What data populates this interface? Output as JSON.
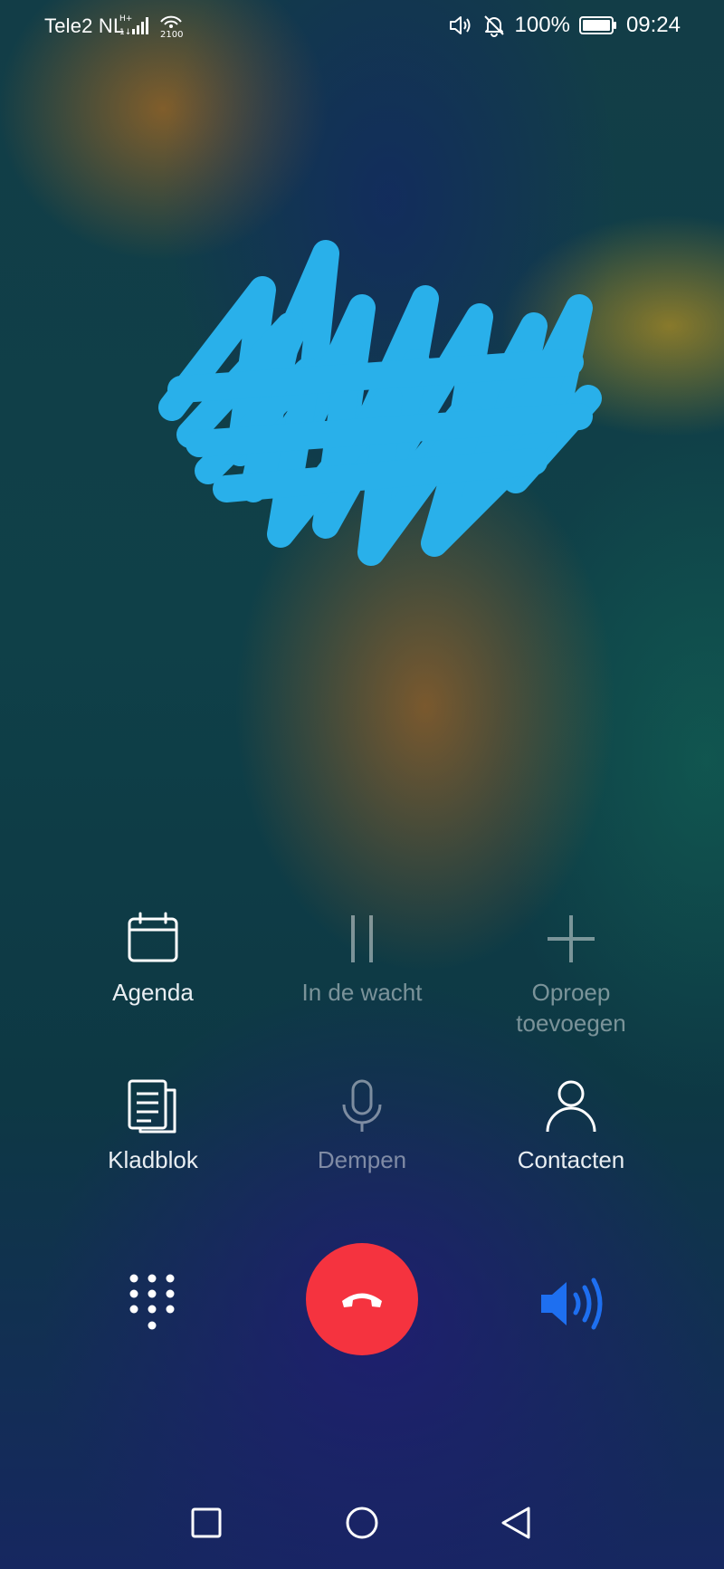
{
  "status_bar": {
    "carrier": "Tele2 NL",
    "network_badge": "2100",
    "battery_percent": "100%",
    "time": "09:24",
    "icons": [
      "signal-icon",
      "wifi-icon",
      "volume-icon",
      "bell-off-icon",
      "battery-icon"
    ]
  },
  "call": {
    "contact_name_redacted": true
  },
  "controls": {
    "agenda": {
      "label": "Agenda",
      "icon": "calendar-icon",
      "enabled": true
    },
    "hold": {
      "label": "In de wacht",
      "icon": "pause-icon",
      "enabled": false
    },
    "add_call": {
      "label_line1": "Oproep",
      "label_line2": "toevoegen",
      "icon": "plus-icon",
      "enabled": false
    },
    "notepad": {
      "label": "Kladblok",
      "icon": "notes-icon",
      "enabled": true
    },
    "mute": {
      "label": "Dempen",
      "icon": "microphone-icon",
      "enabled": false
    },
    "contacts": {
      "label": "Contacten",
      "icon": "person-icon",
      "enabled": true
    }
  },
  "bottom_actions": {
    "dialpad_icon": "dialpad-icon",
    "end_call_icon": "hang-up-icon",
    "speaker_icon": "speaker-icon",
    "speaker_active": true
  },
  "navigation": {
    "buttons": [
      "recents-icon",
      "home-icon",
      "back-icon"
    ]
  },
  "colors": {
    "end_call": "#f5333f",
    "speaker_active": "#1e6ff0",
    "redaction": "#29b0ea"
  }
}
